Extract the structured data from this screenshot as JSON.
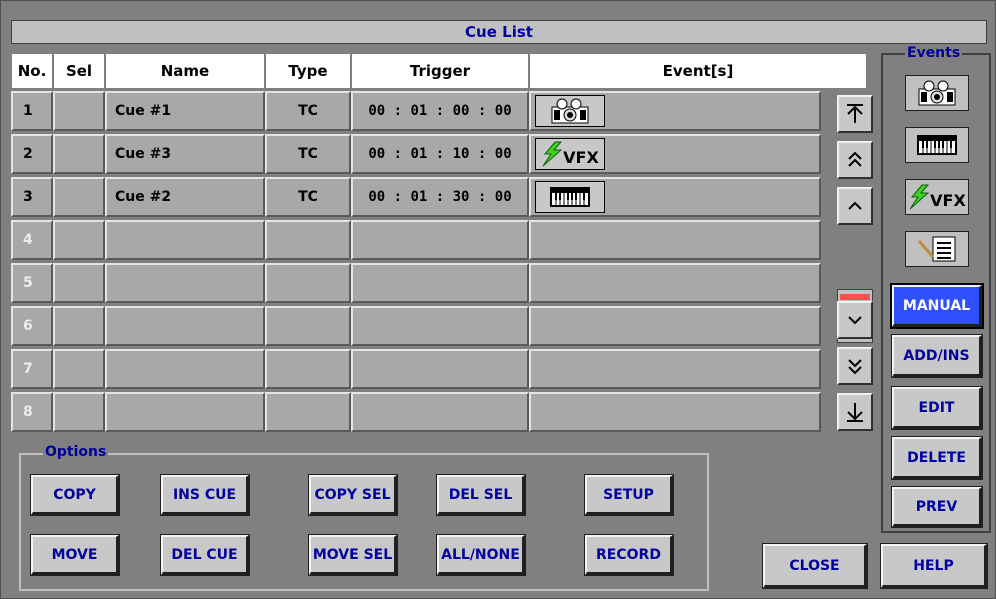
{
  "window": {
    "title": "Cue List"
  },
  "table": {
    "headers": {
      "no": "No.",
      "sel": "Sel",
      "name": "Name",
      "type": "Type",
      "trigger": "Trigger",
      "events": "Event[s]"
    },
    "rows": [
      {
        "no": "1",
        "sel": "",
        "name": "Cue #1",
        "type": "TC",
        "trigger": "00 : 01 : 00 : 00",
        "event": "camera-icon"
      },
      {
        "no": "2",
        "sel": "",
        "name": "Cue #3",
        "type": "TC",
        "trigger": "00 : 01 : 10 : 00",
        "event": "vfx-icon"
      },
      {
        "no": "3",
        "sel": "",
        "name": "Cue #2",
        "type": "TC",
        "trigger": "00 : 01 : 30 : 00",
        "event": "keyboard-icon"
      },
      {
        "no": "4",
        "sel": "",
        "name": "",
        "type": "",
        "trigger": "",
        "event": ""
      },
      {
        "no": "5",
        "sel": "",
        "name": "",
        "type": "",
        "trigger": "",
        "event": ""
      },
      {
        "no": "6",
        "sel": "",
        "name": "",
        "type": "",
        "trigger": "",
        "event": ""
      },
      {
        "no": "7",
        "sel": "",
        "name": "",
        "type": "",
        "trigger": "",
        "event": ""
      },
      {
        "no": "8",
        "sel": "",
        "name": "",
        "type": "",
        "trigger": "",
        "event": ""
      }
    ]
  },
  "scroll": {
    "buttons": [
      "scroll-top-icon",
      "page-up-icon",
      "line-up-icon",
      "line-down-icon",
      "page-down-icon",
      "scroll-bottom-icon"
    ],
    "thumb_color": "#ff5050"
  },
  "events_panel": {
    "title": "Events",
    "icons": [
      "camera-icon",
      "keyboard-icon",
      "vfx-icon",
      "note-icon"
    ],
    "vfx_label": "VFX",
    "buttons": {
      "manual": "MANUAL",
      "add_ins": "ADD/INS",
      "edit": "EDIT",
      "delete": "DELETE",
      "prev": "PREV"
    }
  },
  "options": {
    "title": "Options",
    "buttons": {
      "copy": "COPY",
      "ins_cue": "INS CUE",
      "copy_sel": "COPY SEL",
      "del_sel": "DEL SEL",
      "setup": "SETUP",
      "move": "MOVE",
      "del_cue": "DEL CUE",
      "move_sel": "MOVE SEL",
      "all_none": "ALL/NONE",
      "record": "RECORD"
    }
  },
  "footer": {
    "close": "CLOSE",
    "help": "HELP"
  },
  "colors": {
    "title_text": "#0000a0",
    "active_button": "#3050ff",
    "background": "#808080"
  }
}
